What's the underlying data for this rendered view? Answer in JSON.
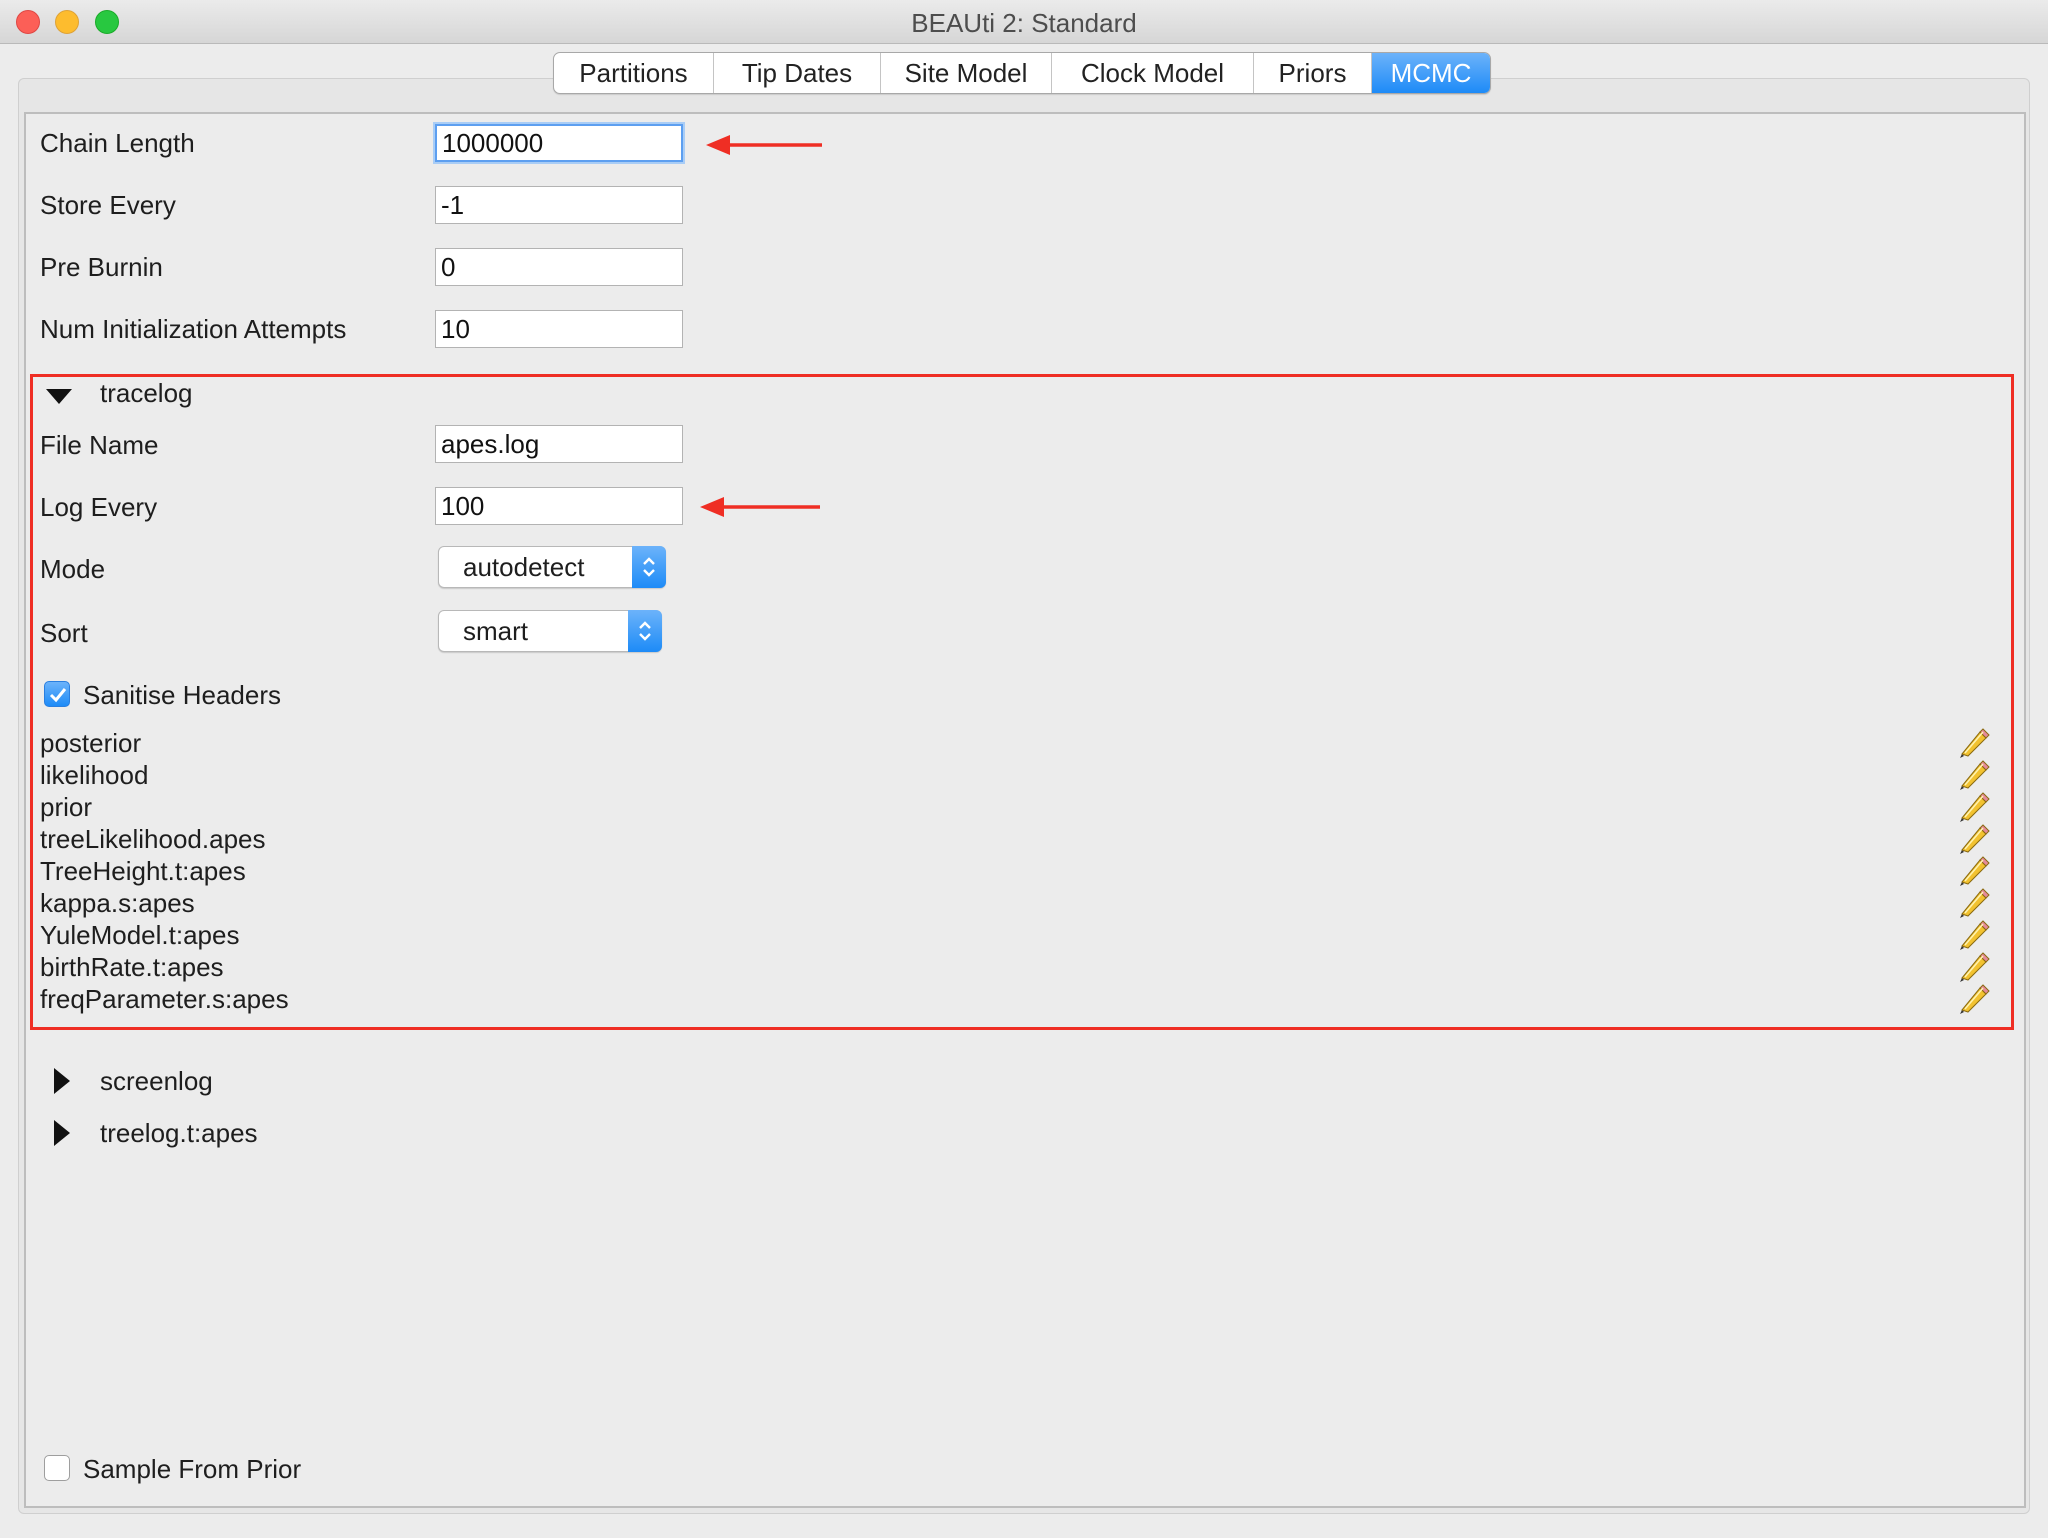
{
  "window": {
    "title": "BEAUti 2: Standard"
  },
  "tabs": [
    {
      "label": "Partitions",
      "active": false
    },
    {
      "label": "Tip Dates",
      "active": false
    },
    {
      "label": "Site Model",
      "active": false
    },
    {
      "label": "Clock Model",
      "active": false
    },
    {
      "label": "Priors",
      "active": false
    },
    {
      "label": "MCMC",
      "active": true
    }
  ],
  "mcmc": {
    "chain_length": {
      "label": "Chain Length",
      "value": "1000000"
    },
    "store_every": {
      "label": "Store Every",
      "value": "-1"
    },
    "pre_burnin": {
      "label": "Pre Burnin",
      "value": "0"
    },
    "num_init": {
      "label": "Num Initialization Attempts",
      "value": "10"
    }
  },
  "tracelog": {
    "title": "tracelog",
    "expanded": true,
    "file_name": {
      "label": "File Name",
      "value": "apes.log"
    },
    "log_every": {
      "label": "Log Every",
      "value": "100"
    },
    "mode": {
      "label": "Mode",
      "value": "autodetect"
    },
    "sort": {
      "label": "Sort",
      "value": "smart"
    },
    "sanitise_headers": {
      "label": "Sanitise Headers",
      "checked": true
    },
    "entries": [
      "posterior",
      "likelihood",
      "prior",
      "treeLikelihood.apes",
      "TreeHeight.t:apes",
      "kappa.s:apes",
      "YuleModel.t:apes",
      "birthRate.t:apes",
      "freqParameter.s:apes"
    ]
  },
  "screenlog": {
    "title": "screenlog",
    "expanded": false
  },
  "treelog": {
    "title": "treelog.t:apes",
    "expanded": false
  },
  "sample_from_prior": {
    "label": "Sample From Prior",
    "checked": false
  },
  "colors": {
    "accent": "#1d8bf7",
    "annotation_red": "#ef2e24",
    "pencil_yellow": "#f2c230"
  },
  "icons": [
    "edit-pencil-icon",
    "disclosure-triangle-icon",
    "select-stepper-icon",
    "annotation-arrow-icon"
  ]
}
